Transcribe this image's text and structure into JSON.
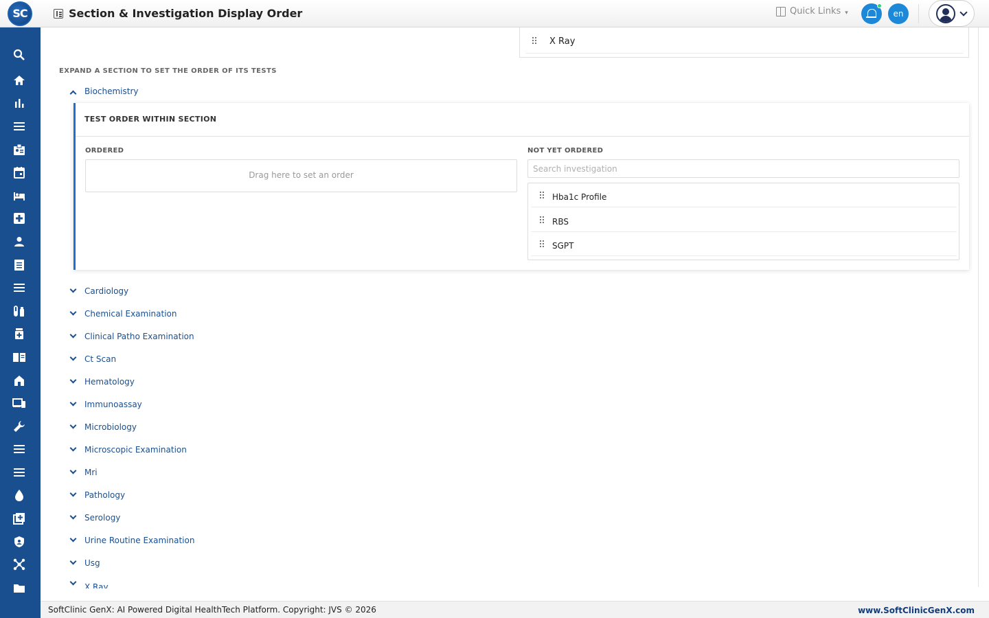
{
  "app": {
    "logo_text": "SC",
    "brand_color": "#1a4f8f",
    "accent_color": "#1e88d8"
  },
  "header": {
    "title": "Section & Investigation Display Order",
    "quick_links_label": "Quick Links",
    "language": "en",
    "notification_status": "online"
  },
  "sidebar": {
    "icons": [
      "search-icon",
      "home-icon",
      "bar-chart-icon",
      "menu-icon",
      "id-badge-icon",
      "calendar-icon",
      "bed-icon",
      "medical-plus-icon",
      "person-icon",
      "document-list-icon",
      "menu-icon",
      "lab-tubes-icon",
      "medicine-bottle-icon",
      "book-icon",
      "building-icon",
      "devices-icon",
      "wrench-icon",
      "menu-icon",
      "menu-icon",
      "blood-drop-icon",
      "add-box-icon",
      "shield-icon",
      "network-icon",
      "folder-icon"
    ]
  },
  "top_card": {
    "label": "X Ray"
  },
  "expand_hint": "EXPAND A SECTION TO SET THE ORDER OF ITS TESTS",
  "expanded_section": {
    "label": "Biochemistry",
    "panel_title": "TEST ORDER WITHIN SECTION",
    "ordered_label": "ORDERED",
    "drop_hint": "Drag here to set an order",
    "not_ordered_label": "NOT YET ORDERED",
    "search_placeholder": "Search investigation",
    "available": [
      "Hba1c Profile",
      "RBS",
      "SGPT"
    ]
  },
  "sections": [
    "Cardiology",
    "Chemical Examination",
    "Clinical Patho Examination",
    "Ct Scan",
    "Hematology",
    "Immunoassay",
    "Microbiology",
    "Microscopic Examination",
    "Mri",
    "Pathology",
    "Serology",
    "Urine Routine Examination",
    "Usg",
    "X Ray"
  ],
  "footer": {
    "copyright": "SoftClinic GenX: AI Powered Digital HealthTech Platform. Copyright: JVS © 2026",
    "website": "www.SoftClinicGenX.com"
  }
}
